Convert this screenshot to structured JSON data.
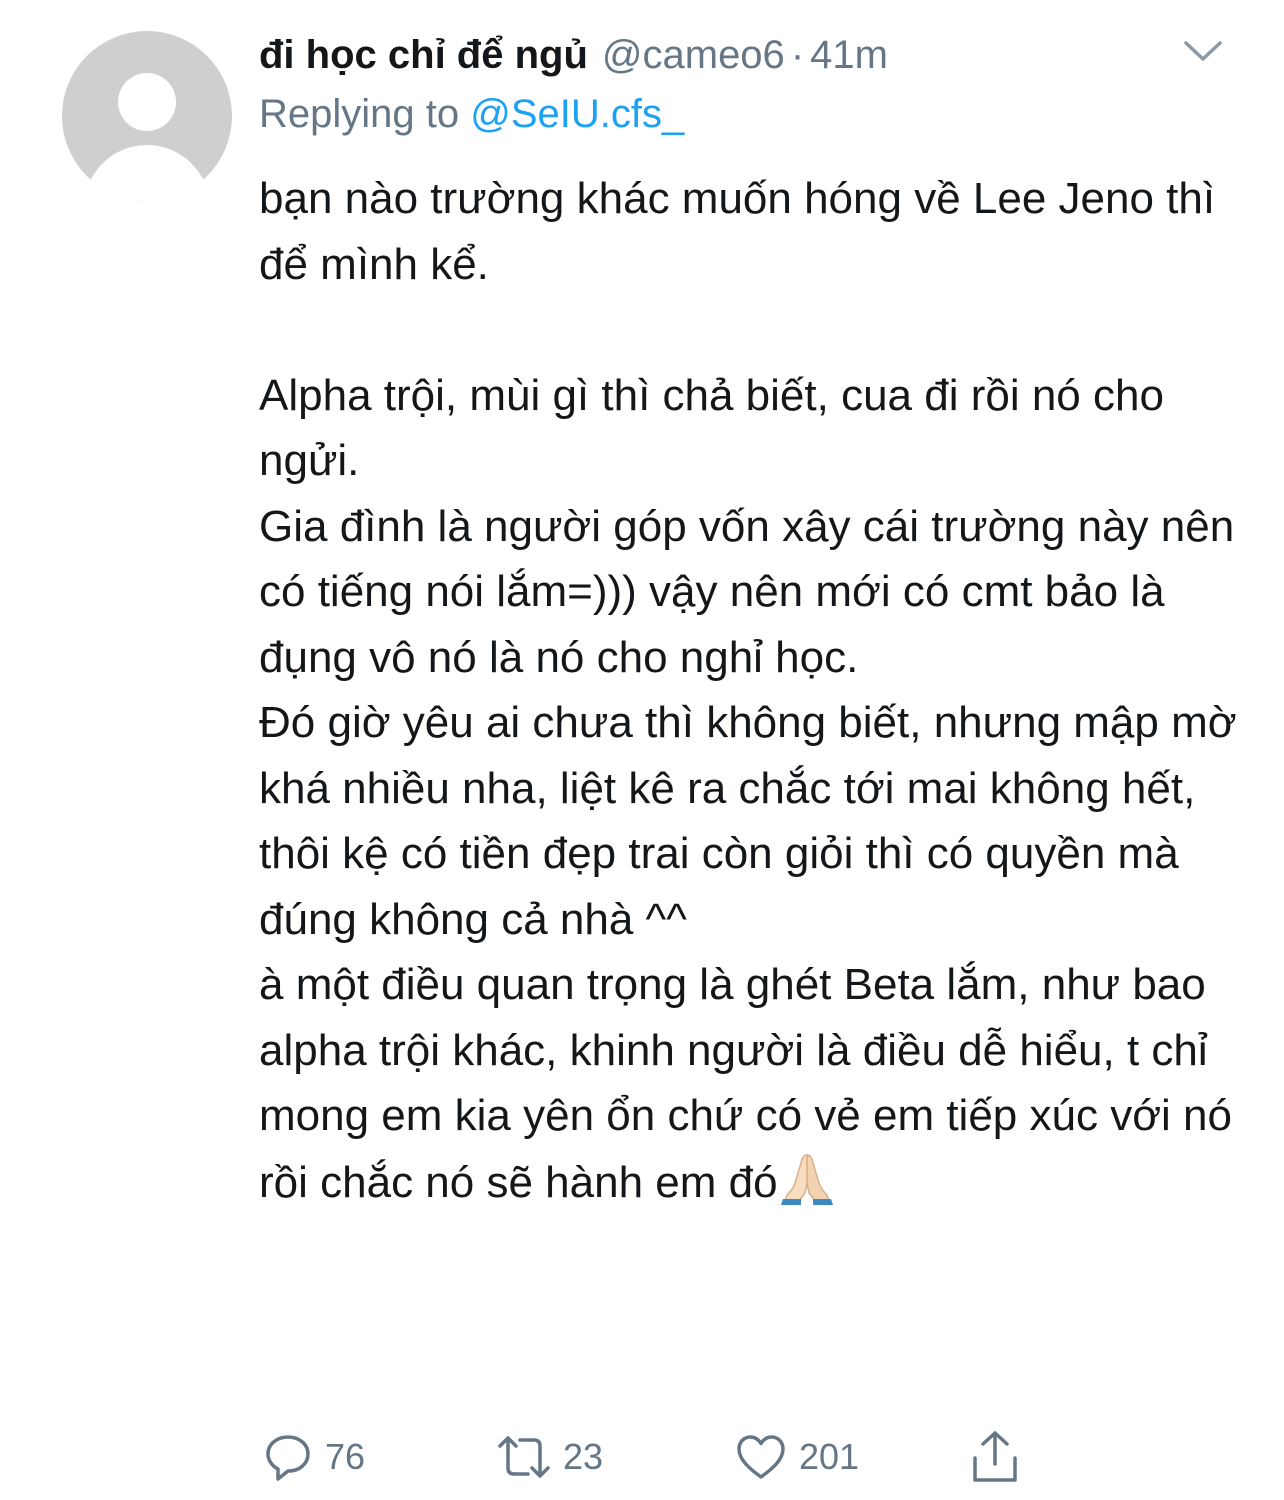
{
  "tweet": {
    "display_name": "đi học chỉ để ngủ",
    "handle": "@cameo6",
    "separator": "·",
    "time": "41m",
    "replying_label": "Replying to",
    "replying_to": "@SeIU.cfs_",
    "paragraphs": [
      "bạn nào trường khác muốn hóng về Lee Jeno thì để mình kể.",
      "",
      "Alpha trội, mùi gì thì chả biết, cua đi rồi nó cho ngửi.",
      "Gia đình là người góp vốn xây cái trường này nên có tiếng nói lắm=))) vậy nên mới có cmt bảo là đụng vô nó là nó cho nghỉ học.",
      "Đó giờ yêu ai chưa thì không biết, nhưng mập mờ khá nhiều nha, liệt kê ra chắc tới mai không hết, thôi kệ có tiền đẹp trai còn giỏi thì có quyền mà đúng không cả nhà ^^",
      "à một điều quan trọng là ghét Beta lắm, như bao alpha trội khác, khinh người là điều dễ hiểu, t chỉ mong em kia yên ổn chứ có vẻ em tiếp xúc với nó rồi chắc nó sẽ hành em đó"
    ],
    "trailing_emoji": "folded-hands-emoji",
    "actions": {
      "replies": "76",
      "retweets": "23",
      "likes": "201"
    }
  },
  "icons": {
    "avatar": "default-avatar-icon",
    "menu": "chevron-down-icon",
    "reply": "reply-icon",
    "retweet": "retweet-icon",
    "like": "heart-icon",
    "share": "share-icon"
  },
  "colors": {
    "text": "#14171a",
    "secondary": "#657786",
    "link": "#1da1f2",
    "avatar_bg": "#cfcfcf"
  }
}
